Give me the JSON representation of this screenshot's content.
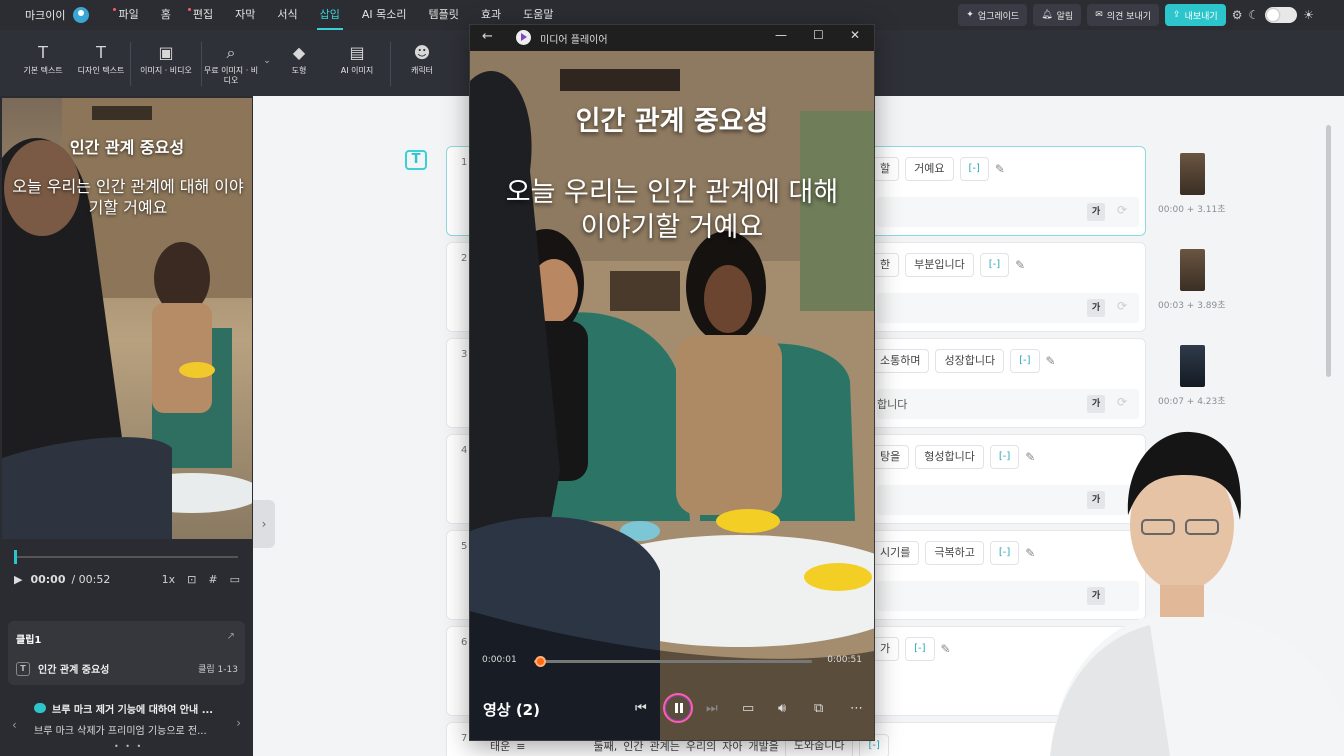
{
  "app": {
    "name": "마크이이"
  },
  "menu": [
    "파일",
    "홈",
    "편집",
    "자막",
    "서식",
    "삽입",
    "AI 목소리",
    "템플릿",
    "효과",
    "도움말"
  ],
  "menu_active": "삽입",
  "top_actions": {
    "upgrade": "업그레이드",
    "alerts": "알림",
    "feedback": "의견 보내기",
    "export": "내보내기"
  },
  "ribbon": [
    {
      "label": "기본 텍스트",
      "icon": "text-icon"
    },
    {
      "label": "디자인 텍스트",
      "icon": "design-text-icon"
    },
    {
      "label": "이미지 · 비디오",
      "icon": "image-icon"
    },
    {
      "label": "무료 이미지 · 비디오",
      "icon": "free-image-icon"
    },
    {
      "label": "도형",
      "icon": "shapes-icon"
    },
    {
      "label": "AI 이미지",
      "icon": "ai-image-icon"
    },
    {
      "label": "캐릭터",
      "icon": "character-icon"
    }
  ],
  "preview": {
    "title": "인간 관계 중요성",
    "subtitle": "오늘 우리는 인간 관계에 대해 이야기할 거예요",
    "current_time": "00:00",
    "duration": "/ 00:52",
    "speed": "1x"
  },
  "clip": {
    "title": "클립1",
    "name": "인간 관계 중요성",
    "range": "클립 1-13"
  },
  "notice": {
    "title": "브루 마크 제거 기능에 대하여 안내 ...",
    "body": "브루 마크 삭제가 프리미엄 기능으로 전..."
  },
  "player": {
    "window_title": "미디어 플레이어",
    "title": "인간 관계 중요성",
    "subtitle_line1": "오늘 우리는 인간 관계에 대해",
    "subtitle_line2": "이야기할 거예요",
    "elapsed": "0:00:01",
    "total": "0:00:51",
    "progress": 0.02,
    "label": "영상 (2)"
  },
  "rows": [
    {
      "num": "1",
      "chips": [
        "할",
        "거예요"
      ],
      "bracket": "[-]",
      "sub": "",
      "thumb_label": "00:00 + 3.11초"
    },
    {
      "num": "2",
      "chips": [
        "한",
        "부분입니다"
      ],
      "bracket": "[-]",
      "sub": "",
      "thumb_label": "00:03 + 3.89초"
    },
    {
      "num": "3",
      "chips": [
        "소통하며",
        "성장합니다"
      ],
      "bracket": "[-]",
      "sub": "합니다",
      "thumb_label": "00:07 + 4.23초"
    },
    {
      "num": "4",
      "chips": [
        "탕을",
        "형성합니다"
      ],
      "bracket": "[-]",
      "sub": "",
      "thumb_label": ""
    },
    {
      "num": "5",
      "chips": [
        "시기를",
        "극복하고"
      ],
      "bracket": "[-]",
      "sub": "",
      "thumb_label": ""
    },
    {
      "num": "6",
      "chips": [
        "가"
      ],
      "bracket": "[-]",
      "sub": "",
      "thumb_label": ""
    }
  ],
  "row7": {
    "num": "7",
    "words": [
      "태운",
      "≡",
      "둘째,",
      "인간",
      "관계는",
      "우리의",
      "자아",
      "개발을",
      "도와줍니다",
      "[-]"
    ]
  },
  "ga_label": "가"
}
